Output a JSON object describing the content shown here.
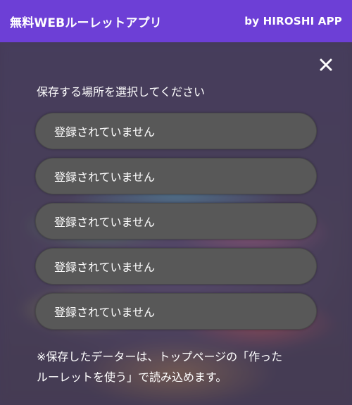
{
  "header": {
    "title": "無料WEBルーレットアプリ",
    "credit": "by HIROSHI APP"
  },
  "dialog": {
    "close_icon": "close-icon",
    "prompt": "保存する場所を選択してください",
    "slots": [
      {
        "label": "登録されていません"
      },
      {
        "label": "登録されていません"
      },
      {
        "label": "登録されていません"
      },
      {
        "label": "登録されていません"
      },
      {
        "label": "登録されていません"
      }
    ],
    "note_line1": "※保存したデーターは、トップページの「作った",
    "note_line2": "ルーレットを使う」で読み込めます。"
  },
  "colors": {
    "header_bg": "#6d3fd6",
    "slot_bg": "#585858",
    "text": "#ffffff"
  }
}
